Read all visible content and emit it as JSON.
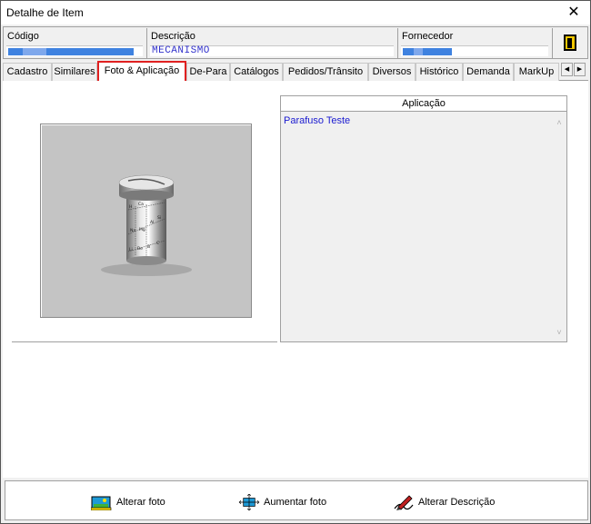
{
  "window": {
    "title": "Detalhe de Item",
    "close_glyph": "✕"
  },
  "header": {
    "codigo_label": "Código",
    "descricao_label": "Descrição",
    "descricao_value": "MECANISMO",
    "fornecedor_label": "Fornecedor"
  },
  "tabs": [
    {
      "label": "Cadastro"
    },
    {
      "label": "Similares"
    },
    {
      "label": "Foto & Aplicação",
      "active": true
    },
    {
      "label": "De-Para"
    },
    {
      "label": "Catálogos"
    },
    {
      "label": "Pedidos/Trânsito"
    },
    {
      "label": "Diversos"
    },
    {
      "label": "Histórico"
    },
    {
      "label": "Demanda"
    },
    {
      "label": "MarkUp"
    }
  ],
  "tab_scroll": {
    "left": "◀",
    "right": "▶"
  },
  "aplicacao": {
    "header": "Aplicação",
    "text": "Parafuso Teste",
    "scroll_up": "˄",
    "scroll_down": "˅"
  },
  "actions": {
    "alterar_foto": "Alterar foto",
    "aumentar_foto": "Aumentar foto",
    "alterar_descricao": "Alterar  Descrição"
  },
  "colors": {
    "active_tab_border": "#e02020",
    "app_text": "#1a1ad0",
    "descricao_value": "#3333cc",
    "exit_icon": "#f2c700"
  }
}
